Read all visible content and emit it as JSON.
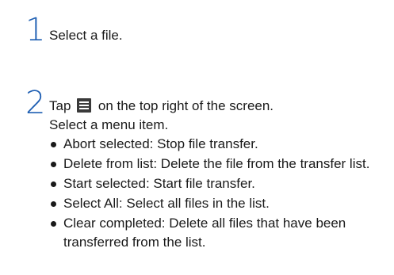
{
  "steps": [
    {
      "number": "1",
      "text": "Select a file."
    },
    {
      "number": "2",
      "text_before_icon": "Tap",
      "icon": "menu-icon",
      "text_after_icon": "on the top right of the screen.",
      "line2": "Select a menu item.",
      "bullets": [
        "Abort selected: Stop file transfer.",
        "Delete from list: Delete the file from the transfer list.",
        "Start selected: Start file transfer.",
        "Select All: Select all files in the list.",
        "Clear completed: Delete all files that have been transferred from the list."
      ]
    }
  ]
}
